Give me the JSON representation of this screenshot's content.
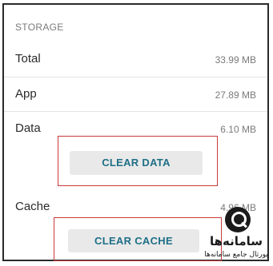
{
  "storage": {
    "section_title": "STORAGE",
    "rows": [
      {
        "label": "Total",
        "value": "33.99 MB"
      },
      {
        "label": "App",
        "value": "27.89 MB"
      },
      {
        "label": "Data",
        "value": "6.10 MB"
      },
      {
        "label": "Cache",
        "value": "4.96 MB"
      }
    ],
    "clear_data_label": "CLEAR DATA",
    "clear_cache_label": "CLEAR CACHE"
  },
  "watermark": {
    "icon": "magnifier-icon",
    "title": "سامانه‌ها",
    "subtitle": "پورتال جامع سامانه‌ها"
  },
  "colors": {
    "button_text": "#1e6f86",
    "highlight_border": "#c83a3a"
  }
}
